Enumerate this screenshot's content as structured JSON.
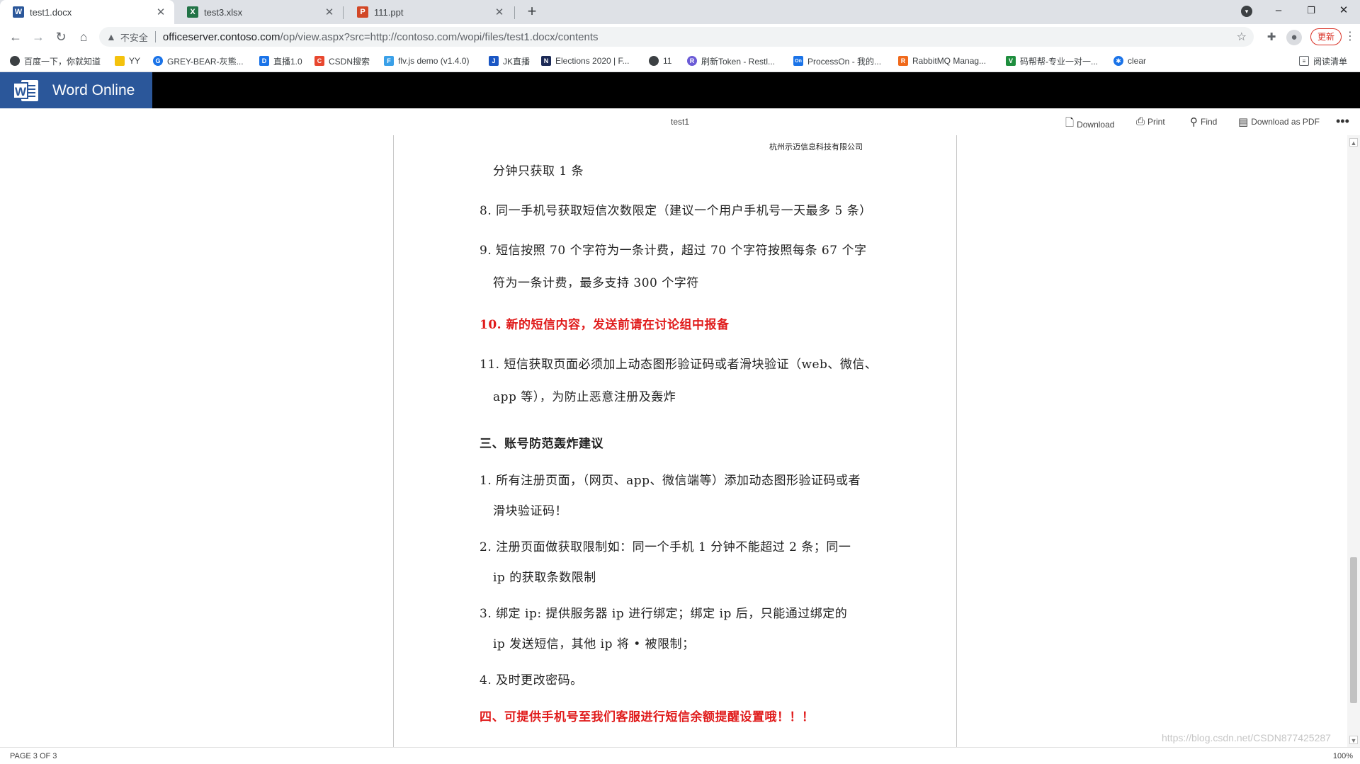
{
  "browser": {
    "tabs": [
      {
        "title": "test1.docx",
        "icon": "word-icon",
        "color": "#2b579a",
        "letter": "W"
      },
      {
        "title": "test3.xlsx",
        "icon": "excel-icon",
        "color": "#217346",
        "letter": "X"
      },
      {
        "title": "111.ppt",
        "icon": "powerpoint-icon",
        "color": "#d24726",
        "letter": "P"
      }
    ],
    "new_tab": "+",
    "window_controls": {
      "minimize": "–",
      "restore": "❐",
      "close": "✕"
    },
    "address": {
      "security_label": "不安全",
      "host": "officeserver.contoso.com",
      "path": "/op/view.aspx?src=http://contoso.com/wopi/files/test1.docx/contents"
    },
    "update_label": "更新",
    "bookmarks": [
      {
        "label": "百度一下，你就知道",
        "color": "#3c4043",
        "letter": "●"
      },
      {
        "label": "YY",
        "color": "#f4c20d",
        "letter": ""
      },
      {
        "label": "GREY-BEAR-灰熊...",
        "color": "#1a73e8",
        "letter": "G"
      },
      {
        "label": "直播1.0",
        "color": "#1a73e8",
        "letter": "D"
      },
      {
        "label": "CSDN搜索",
        "color": "#e8472f",
        "letter": "C"
      },
      {
        "label": "flv.js demo (v1.4.0)",
        "color": "#3aa0e8",
        "letter": "F"
      },
      {
        "label": "JK直播",
        "color": "#1a56c4",
        "letter": "J"
      },
      {
        "label": "Elections 2020 | F...",
        "color": "#1c2a56",
        "letter": "N"
      },
      {
        "label": "11",
        "color": "#3c4043",
        "letter": "●"
      },
      {
        "label": "刷新Token - Restl...",
        "color": "#6b5bd6",
        "letter": "R"
      },
      {
        "label": "ProcessOn - 我的...",
        "color": "#1a73e8",
        "letter": "On"
      },
      {
        "label": "RabbitMQ Manag...",
        "color": "#f06a1c",
        "letter": "R"
      },
      {
        "label": "码帮帮-专业一对一...",
        "color": "#1e8e3e",
        "letter": "V"
      },
      {
        "label": "clear",
        "color": "#1a73e8",
        "letter": "✱"
      }
    ],
    "reading_list": "阅读清单"
  },
  "word": {
    "app_title": "Word Online",
    "doc_name": "test1",
    "commands": {
      "download": "Download",
      "print": "Print",
      "find": "Find",
      "download_pdf": "Download as PDF",
      "more": "•••"
    }
  },
  "document": {
    "header_company": "杭州示迈信息科技有限公司",
    "lines": [
      {
        "text": "分钟只获取 1 条",
        "style": "indent"
      },
      {
        "text": "8. 同一手机号获取短信次数限定（建议一个用户手机号一天最多 5 条）",
        "style": ""
      },
      {
        "text": "9. 短信按照 70 个字符为一条计费，超过 70 个字符按照每条 67 个字",
        "style": ""
      },
      {
        "text": "符为一条计费，最多支持 300 个字符",
        "style": "indent"
      },
      {
        "text": "10. 新的短信内容，发送前请在讨论组中报备",
        "style": "red"
      },
      {
        "text": "11. 短信获取页面必须加上动态图形验证码或者滑块验证（web、微信、",
        "style": ""
      },
      {
        "text": "app 等），为防止恶意注册及轰炸",
        "style": "indent"
      },
      {
        "text": "三、账号防范轰炸建议",
        "style": "heading"
      },
      {
        "text": "1. 所有注册页面，（网页、app、微信端等）添加动态图形验证码或者",
        "style": ""
      },
      {
        "text": "滑块验证码！",
        "style": "indent"
      },
      {
        "text": "2. 注册页面做获取限制如：同一个手机 1 分钟不能超过 2 条；同一",
        "style": ""
      },
      {
        "text": "ip 的获取条数限制",
        "style": "indent"
      },
      {
        "text": "3. 绑定 ip: 提供服务器 ip 进行绑定；绑定 ip 后，只能通过绑定的",
        "style": ""
      },
      {
        "text": "ip 发送短信，其他 ip 将 • 被限制；",
        "style": "indent"
      },
      {
        "text": "4. 及时更改密码。",
        "style": ""
      },
      {
        "text": "四、可提供手机号至我们客服进行短信余额提醒设置哦！！！",
        "style": "red"
      }
    ]
  },
  "status": {
    "page_info": "PAGE 3 OF 3",
    "zoom": "100%",
    "watermark": "https://blog.csdn.net/CSDN877425287"
  }
}
